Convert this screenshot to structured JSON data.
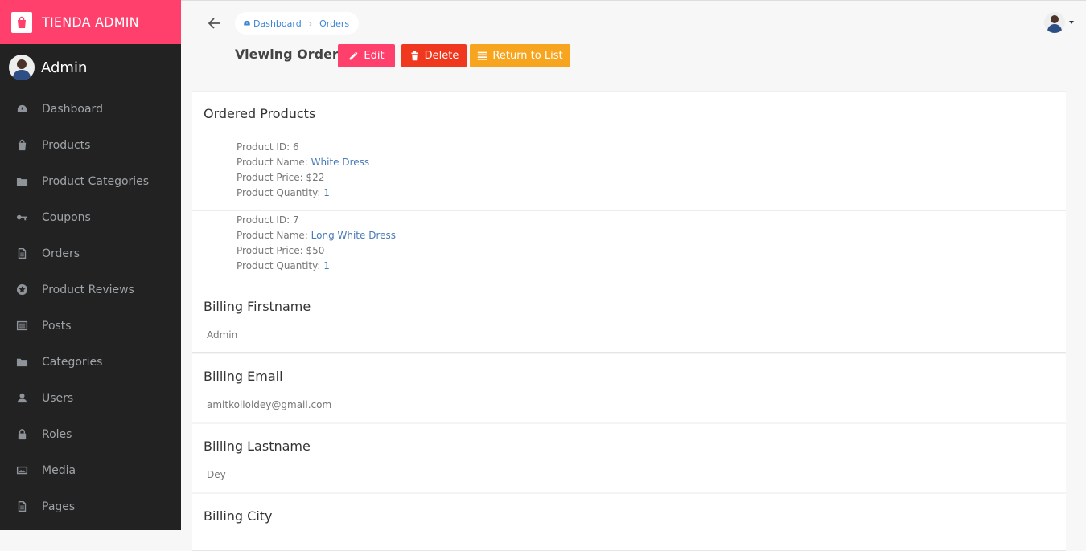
{
  "brand": {
    "title": "TIENDA ADMIN"
  },
  "sidebar": {
    "user_name": "Admin",
    "items": [
      {
        "label": "Dashboard",
        "icon": "dashboard-icon"
      },
      {
        "label": "Products",
        "icon": "shopping-bag-icon"
      },
      {
        "label": "Product Categories",
        "icon": "folder-icon"
      },
      {
        "label": "Coupons",
        "icon": "key-icon"
      },
      {
        "label": "Orders",
        "icon": "file-icon"
      },
      {
        "label": "Product Reviews",
        "icon": "star-icon"
      },
      {
        "label": "Posts",
        "icon": "newspaper-icon"
      },
      {
        "label": "Categories",
        "icon": "folder-icon"
      },
      {
        "label": "Users",
        "icon": "user-icon"
      },
      {
        "label": "Roles",
        "icon": "lock-icon"
      },
      {
        "label": "Media",
        "icon": "image-icon"
      },
      {
        "label": "Pages",
        "icon": "file-icon"
      }
    ]
  },
  "header": {
    "breadcrumb": [
      "Dashboard",
      "Orders"
    ]
  },
  "page": {
    "title": "Viewing Order",
    "buttons": {
      "edit": "Edit",
      "delete": "Delete",
      "return": "Return to List"
    }
  },
  "order": {
    "ordered_products_title": "Ordered Products",
    "labels": {
      "id": "Product ID: ",
      "name": "Product Name: ",
      "price": "Product Price: ",
      "quantity": "Product Quantity: "
    },
    "products": [
      {
        "id": "6",
        "name": "White Dress",
        "price": "$22",
        "quantity": "1"
      },
      {
        "id": "7",
        "name": "Long White Dress",
        "price": "$50",
        "quantity": "1"
      }
    ],
    "fields": [
      {
        "label": "Billing Firstname",
        "value": "Admin"
      },
      {
        "label": "Billing Email",
        "value": "amitkolloldey@gmail.com"
      },
      {
        "label": "Billing Lastname",
        "value": "Dey"
      },
      {
        "label": "Billing City",
        "value": ""
      }
    ]
  },
  "colors": {
    "brand": "#ff3f6c",
    "sidebar_bg": "#222222",
    "delete": "#f0381f",
    "return": "#f7a41f",
    "link": "#3b86d6"
  }
}
